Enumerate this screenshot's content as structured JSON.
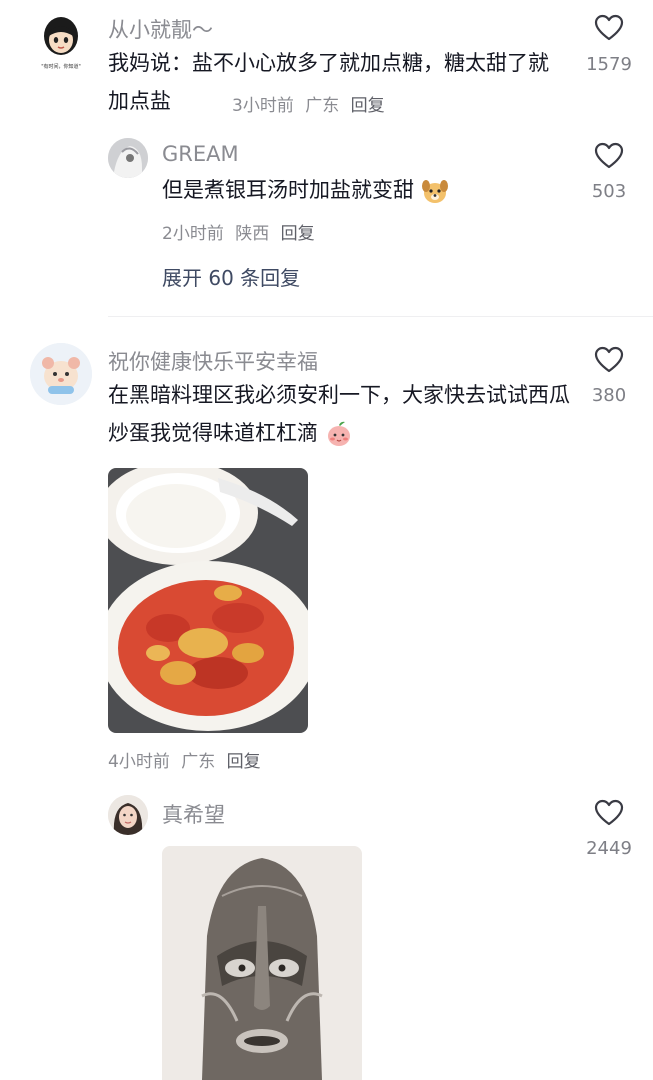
{
  "comments": [
    {
      "username": "从小就靓～",
      "text": "我妈说：盐不小心放多了就加点糖，糖太甜了就加点盐",
      "time": "3小时前",
      "location": "广东",
      "reply_label": "回复",
      "likes": "1579",
      "avatar_caption": "\"有时间，你知道\""
    },
    {
      "username": "GREAM",
      "text": "但是煮银耳汤时加盐就变甜",
      "time": "2小时前",
      "location": "陕西",
      "reply_label": "回复",
      "likes": "503",
      "expand_label": "展开 60 条回复"
    },
    {
      "username": "祝你健康快乐平安幸福",
      "text": "在黑暗料理区我必须安利一下，大家快去试试西瓜炒蛋我觉得味道杠杠滴",
      "time": "4小时前",
      "location": "广东",
      "reply_label": "回复",
      "likes": "380"
    },
    {
      "username": "真希望",
      "likes": "2449"
    }
  ],
  "icons": {
    "like": "heart-outline-icon",
    "emoji_2": "dog-face-emoji",
    "emoji_3": "blushing-peach-emoji"
  }
}
